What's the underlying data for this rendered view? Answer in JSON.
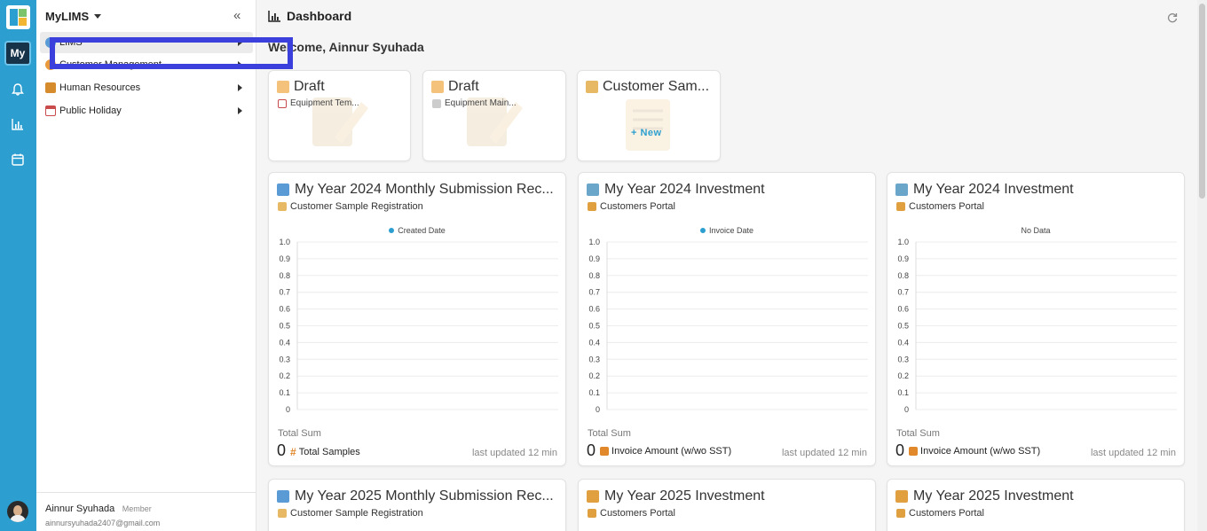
{
  "sidebar": {
    "app_name": "MyLIMS",
    "items": [
      {
        "label": "LIMS",
        "color": "#5b9bd5"
      },
      {
        "label": "Customer Management",
        "color": "#e89a3c"
      },
      {
        "label": "Human Resources",
        "color": "#d68b2c"
      },
      {
        "label": "Public Holiday",
        "color": "#c94b4b"
      }
    ],
    "user_name": "Ainnur Syuhada",
    "user_role": "Member",
    "user_email": "ainnursyuhada2407@gmail.com"
  },
  "rail": {
    "my_label": "My",
    "icons": [
      "bell-icon",
      "bar-chart-icon",
      "calendar-icon"
    ]
  },
  "header": {
    "title": "Dashboard"
  },
  "welcome": "Welcome, Ainnur Syuhada",
  "small_cards": [
    {
      "title": "Draft",
      "subtitle": "Equipment Tem...",
      "action": ""
    },
    {
      "title": "Draft",
      "subtitle": "Equipment Main...",
      "action": ""
    },
    {
      "title": "Customer Sam...",
      "subtitle": "",
      "action": "+ New"
    }
  ],
  "chart_cards": [
    {
      "title": "My Year 2024 Monthly Submission Rec...",
      "subtitle": "Customer Sample Registration",
      "legend": "Created Date",
      "total_label": "Total Sum",
      "total_value": "0",
      "total_unit": "Total Samples",
      "updated": "last updated 12 min"
    },
    {
      "title": "My Year 2024 Investment",
      "subtitle": "Customers Portal",
      "legend": "Invoice Date",
      "total_label": "Total Sum",
      "total_value": "0",
      "total_unit": "Invoice Amount (w/wo SST)",
      "updated": "last updated 12 min"
    },
    {
      "title": "My Year 2024 Investment",
      "subtitle": "Customers Portal",
      "legend": "No Data",
      "total_label": "Total Sum",
      "total_value": "0",
      "total_unit": "Invoice Amount (w/wo SST)",
      "updated": "last updated 12 min"
    },
    {
      "title": "My Year 2025 Monthly Submission Rec...",
      "subtitle": "Customer Sample Registration"
    },
    {
      "title": "My Year 2025 Investment",
      "subtitle": "Customers Portal"
    },
    {
      "title": "My Year 2025 Investment",
      "subtitle": "Customers Portal"
    }
  ],
  "chart_data": [
    {
      "type": "bar",
      "legend": "Created Date",
      "values": [],
      "yticks": [
        "1.0",
        "0.9",
        "0.8",
        "0.7",
        "0.6",
        "0.5",
        "0.4",
        "0.3",
        "0.2",
        "0.1",
        "0"
      ],
      "ylim": [
        0,
        1
      ]
    },
    {
      "type": "bar",
      "legend": "Invoice Date",
      "values": [],
      "yticks": [
        "1.0",
        "0.9",
        "0.8",
        "0.7",
        "0.6",
        "0.5",
        "0.4",
        "0.3",
        "0.2",
        "0.1",
        "0"
      ],
      "ylim": [
        0,
        1
      ]
    },
    {
      "type": "bar",
      "legend": "No Data",
      "values": [],
      "yticks": [
        "1.0",
        "0.9",
        "0.8",
        "0.7",
        "0.6",
        "0.5",
        "0.4",
        "0.3",
        "0.2",
        "0.1",
        "0"
      ],
      "ylim": [
        0,
        1
      ]
    }
  ],
  "colors": {
    "rail": "#2c9fd0",
    "accent": "#2c9fd0",
    "highlight": "#3b3fdc"
  }
}
